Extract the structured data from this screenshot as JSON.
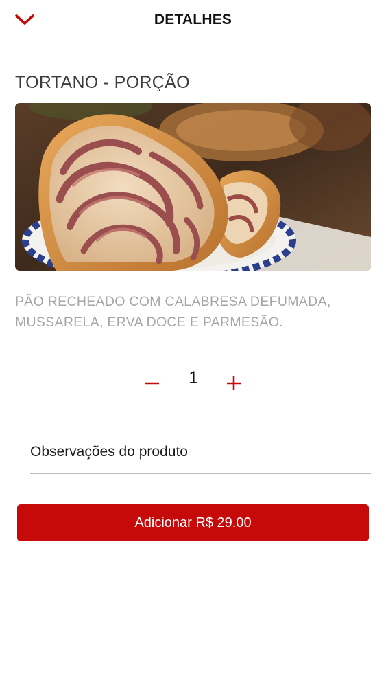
{
  "header": {
    "title": "DETALHES",
    "back_icon": "chevron-down-icon"
  },
  "product": {
    "title": "TORTANO - PORÇÃO",
    "image_alt": "Tortano fatiado recheado com calabresa",
    "description": "PÃO RECHEADO COM CALABRESA DEFUMADA, MUSSARELA, ERVA DOCE E PARMESÃO."
  },
  "quantity": {
    "value": "1",
    "minus_icon": "minus-icon",
    "plus_icon": "plus-icon"
  },
  "notes": {
    "label": "Observações do produto"
  },
  "add_button": {
    "label": "Adicionar",
    "price": "R$ 29.00"
  },
  "colors": {
    "accent": "#c60a0a",
    "title_text": "#3c3c3c",
    "description_text": "#a6a6a6",
    "divider": "#e3e3e3"
  }
}
